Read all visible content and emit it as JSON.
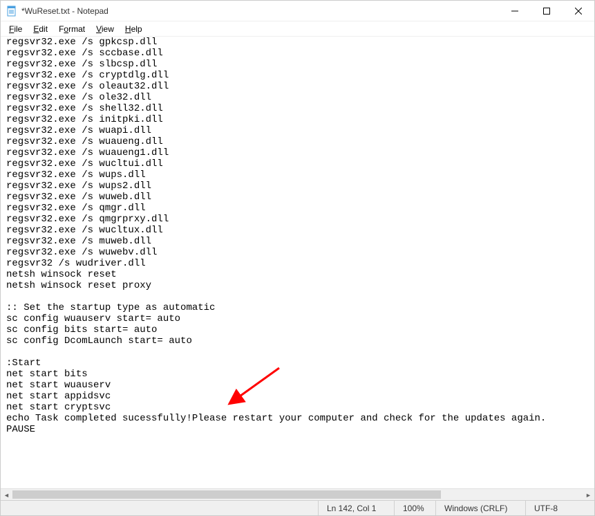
{
  "titlebar": {
    "title": "*WuReset.txt - Notepad"
  },
  "menubar": {
    "file": "File",
    "edit": "Edit",
    "format": "Format",
    "view": "View",
    "help": "Help"
  },
  "content": {
    "lines": [
      "regsvr32.exe /s gpkcsp.dll",
      "regsvr32.exe /s sccbase.dll",
      "regsvr32.exe /s slbcsp.dll",
      "regsvr32.exe /s cryptdlg.dll",
      "regsvr32.exe /s oleaut32.dll",
      "regsvr32.exe /s ole32.dll",
      "regsvr32.exe /s shell32.dll",
      "regsvr32.exe /s initpki.dll",
      "regsvr32.exe /s wuapi.dll",
      "regsvr32.exe /s wuaueng.dll",
      "regsvr32.exe /s wuaueng1.dll",
      "regsvr32.exe /s wucltui.dll",
      "regsvr32.exe /s wups.dll",
      "regsvr32.exe /s wups2.dll",
      "regsvr32.exe /s wuweb.dll",
      "regsvr32.exe /s qmgr.dll",
      "regsvr32.exe /s qmgrprxy.dll",
      "regsvr32.exe /s wucltux.dll",
      "regsvr32.exe /s muweb.dll",
      "regsvr32.exe /s wuwebv.dll",
      "regsvr32 /s wudriver.dll",
      "netsh winsock reset",
      "netsh winsock reset proxy",
      "",
      ":: Set the startup type as automatic",
      "sc config wuauserv start= auto",
      "sc config bits start= auto",
      "sc config DcomLaunch start= auto",
      "",
      ":Start",
      "net start bits",
      "net start wuauserv",
      "net start appidsvc",
      "net start cryptsvc",
      "echo Task completed sucessfully!Please restart your computer and check for the updates again.",
      "PAUSE"
    ]
  },
  "statusbar": {
    "position": "Ln 142, Col 1",
    "zoom": "100%",
    "line_ending": "Windows (CRLF)",
    "encoding": "UTF-8"
  }
}
